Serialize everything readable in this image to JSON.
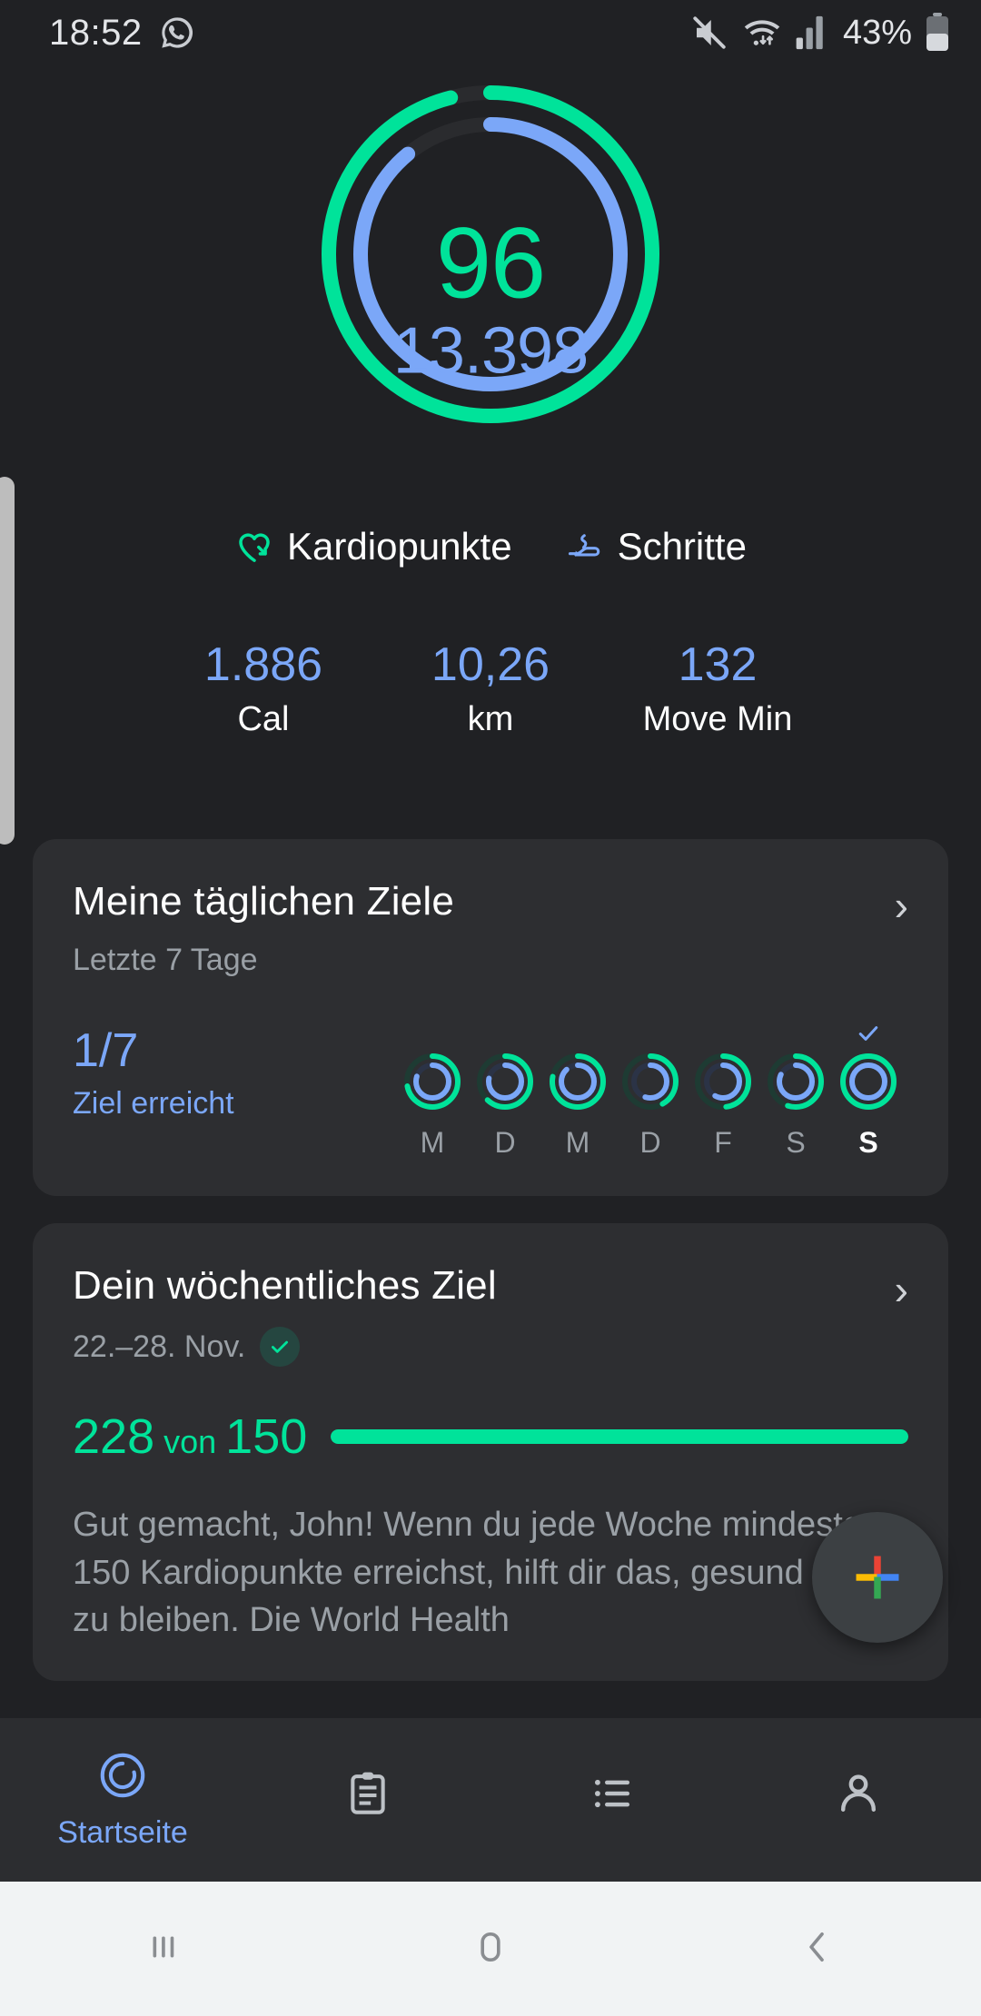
{
  "status_bar": {
    "time": "18:52",
    "battery_percent": "43%",
    "icons": [
      "whatsapp-icon",
      "mute-icon",
      "wifi-icon",
      "signal-icon",
      "battery-icon"
    ]
  },
  "rings": {
    "cardio_points": "96",
    "steps": "13.398",
    "cardio_color": "#00e39a",
    "steps_color": "#7ba7f8",
    "cardio_progress_pct": 96,
    "steps_progress_pct": 89
  },
  "legend": [
    {
      "label": "Kardiopunkte",
      "icon": "heart-arrow-icon",
      "color": "#00e39a"
    },
    {
      "label": "Schritte",
      "icon": "shoe-icon",
      "color": "#7ba7f8"
    }
  ],
  "stats": [
    {
      "value": "1.886",
      "unit": "Cal"
    },
    {
      "value": "10,26",
      "unit": "km"
    },
    {
      "value": "132",
      "unit": "Move Min"
    }
  ],
  "daily_goals_card": {
    "title": "Meine täglichen Ziele",
    "subtitle": "Letzte 7 Tage",
    "chevron": "›",
    "fraction": "1/7",
    "fraction_label": "Ziel erreicht",
    "days": [
      {
        "label": "M",
        "cardio_pct": 72,
        "steps_pct": 80,
        "achieved": false,
        "today": false
      },
      {
        "label": "D",
        "cardio_pct": 62,
        "steps_pct": 78,
        "achieved": false,
        "today": false
      },
      {
        "label": "M",
        "cardio_pct": 78,
        "steps_pct": 88,
        "achieved": false,
        "today": false
      },
      {
        "label": "D",
        "cardio_pct": 42,
        "steps_pct": 55,
        "achieved": false,
        "today": false
      },
      {
        "label": "F",
        "cardio_pct": 48,
        "steps_pct": 58,
        "achieved": false,
        "today": false
      },
      {
        "label": "S",
        "cardio_pct": 55,
        "steps_pct": 82,
        "achieved": false,
        "today": false
      },
      {
        "label": "S",
        "cardio_pct": 100,
        "steps_pct": 100,
        "achieved": true,
        "today": true
      }
    ],
    "check_icon": "check-icon"
  },
  "weekly_goal_card": {
    "title": "Dein wöchentliches Ziel",
    "date_range": "22.–28. Nov.",
    "chevron": "›",
    "achieved_badge": "check-icon",
    "current": "228",
    "of_word": "von",
    "target": "150",
    "progress_pct": 100,
    "description": "Gut gemacht, John! Wenn du jede Woche mindestens 150 Kardiopunkte erreichst, hilft dir das, gesund und fit zu bleiben. Die World Health"
  },
  "fab": {
    "icon": "google-plus-icon",
    "colors": [
      "#ea4335",
      "#fbbc04",
      "#4285f4",
      "#34a853"
    ]
  },
  "bottom_nav": [
    {
      "label": "Startseite",
      "icon": "home-ring-icon",
      "active": true
    },
    {
      "label": "",
      "icon": "journal-icon",
      "active": false
    },
    {
      "label": "",
      "icon": "list-icon",
      "active": false
    },
    {
      "label": "",
      "icon": "profile-icon",
      "active": false
    }
  ],
  "android_nav": [
    {
      "icon": "recents-icon"
    },
    {
      "icon": "home-icon"
    },
    {
      "icon": "back-icon"
    }
  ]
}
